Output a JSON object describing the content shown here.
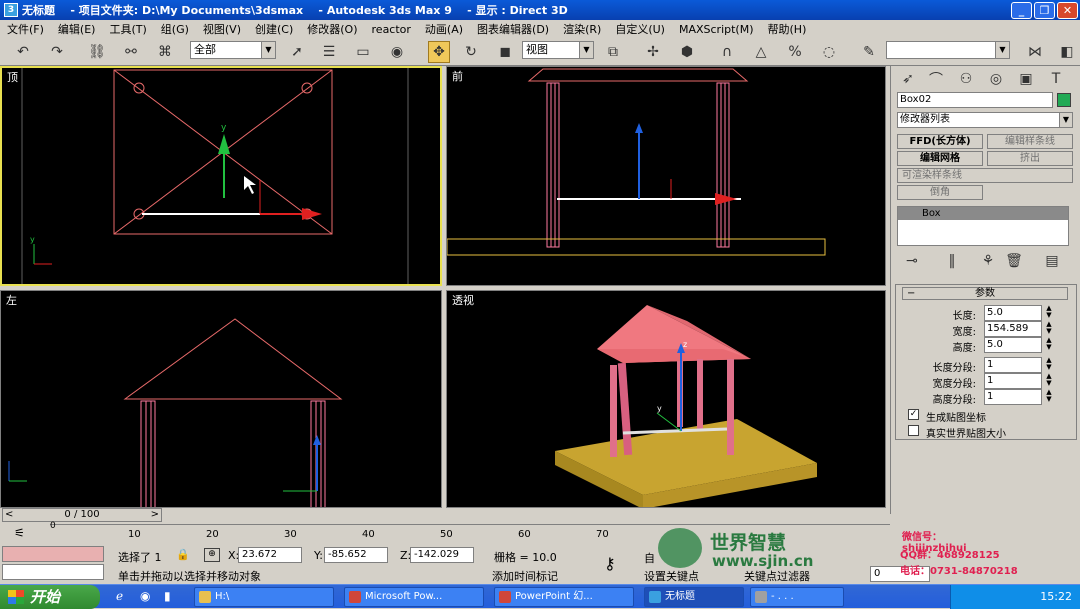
{
  "window": {
    "title": "无标题    - 项目文件夹: D:\\My Documents\\3dsmax    - Autodesk 3ds Max 9    - 显示 : Direct 3D"
  },
  "menu": [
    "文件(F)",
    "编辑(E)",
    "工具(T)",
    "组(G)",
    "视图(V)",
    "创建(C)",
    "修改器(O)",
    "reactor",
    "动画(A)",
    "图表编辑器(D)",
    "渲染(R)",
    "自定义(U)",
    "MAXScript(M)",
    "帮助(H)"
  ],
  "toolbar": {
    "selection_filter": "全部",
    "ref_coord": "视图",
    "named_selection": ""
  },
  "viewports": {
    "top": "顶",
    "front": "前",
    "left": "左",
    "perspective": "透视"
  },
  "command_panel": {
    "object_name": "Box02",
    "object_color": "#22aa55",
    "modifier_list": "修改器列表",
    "buttons": [
      "FFD(长方体)",
      "编辑样条线",
      "编辑网格",
      "挤出",
      "可渲染样条线",
      "倒角"
    ],
    "stack_item": "Box",
    "rollout_title": "参数",
    "params": [
      {
        "label": "长度:",
        "value": "5.0"
      },
      {
        "label": "宽度:",
        "value": "154.589"
      },
      {
        "label": "高度:",
        "value": "5.0"
      },
      {
        "label": "长度分段:",
        "value": "1"
      },
      {
        "label": "宽度分段:",
        "value": "1"
      },
      {
        "label": "高度分段:",
        "value": "1"
      }
    ],
    "checks": [
      {
        "label": "生成贴图坐标",
        "checked": true
      },
      {
        "label": "真实世界贴图大小",
        "checked": false
      }
    ]
  },
  "timeline": {
    "frame_display": "0 / 100",
    "ticks": [
      "0",
      "10",
      "20",
      "30",
      "40",
      "50",
      "60",
      "70"
    ]
  },
  "status": {
    "selected": "选择了 1",
    "x_label": "X:",
    "x": "23.672",
    "y_label": "Y:",
    "y": "-85.652",
    "z_label": "Z:",
    "z": "-142.029",
    "grid": "栅格 = 10.0",
    "prompt": "单击并拖动以选择并移动对象",
    "add_time_tag": "添加时间标记",
    "auto_key": "自",
    "set_key": "设置关键点",
    "key_filters": "关键点过滤器",
    "frame_field": "0"
  },
  "watermark": {
    "brand": "世界智慧",
    "site": "www.sjin.cn",
    "wechat": "微信号：shijinzhihui",
    "qq": "QQ群：468928125",
    "phone": "电话：0731-84870218"
  },
  "taskbar": {
    "start": "开始",
    "tasks": [
      "H:\\",
      "Microsoft Pow...",
      "PowerPoint 幻...",
      "无标题",
      "- . . ."
    ],
    "clock": "15:22"
  }
}
